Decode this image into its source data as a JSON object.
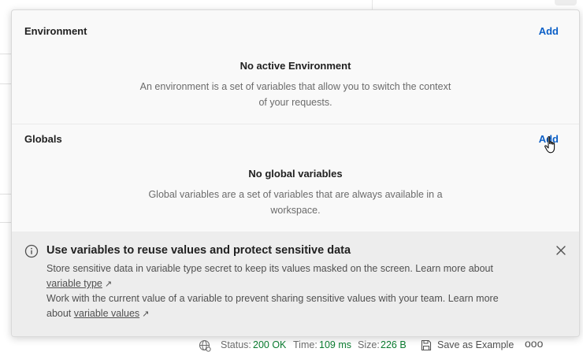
{
  "environment": {
    "title": "Environment",
    "add_label": "Add",
    "empty_title": "No active Environment",
    "empty_desc": "An environment is a set of variables that allow you to switch the context of your requests."
  },
  "globals": {
    "title": "Globals",
    "add_label": "Add",
    "empty_title": "No global variables",
    "empty_desc": "Global variables are a set of variables that are always available in a workspace."
  },
  "banner": {
    "icon": "info-icon",
    "title": "Use variables to reuse values and protect sensitive data",
    "line1": "Store sensitive data in variable type secret to keep its values masked on the screen. Learn more about",
    "link1": "variable type",
    "line2": "Work with the current value of a variable to prevent sharing sensitive values with your team. Learn more",
    "line2_prefix": "about",
    "link2": "variable values",
    "external_glyph": "↗"
  },
  "statusbar": {
    "status_label": "Status:",
    "status_value": "200 OK",
    "time_label": "Time:",
    "time_value": "109 ms",
    "size_label": "Size:",
    "size_value": "226 B",
    "save_label": "Save as Example",
    "more_glyph": "ooo"
  },
  "colors": {
    "link": "#0b5fc7",
    "status_ok": "#0a7a2f",
    "banner_bg": "#ededed"
  }
}
